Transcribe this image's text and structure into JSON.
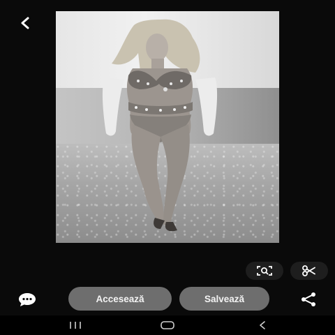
{
  "top_bar": {
    "back_icon": "chevron-left-icon"
  },
  "photo": {
    "description_icon": "runway-photo",
    "tone": "grayscale"
  },
  "tools": {
    "lens_icon": "visual-search-icon",
    "cut_icon": "scissors-icon"
  },
  "actions": {
    "comment_icon": "comment-icon",
    "visit_label": "Accesează",
    "save_label": "Salvează",
    "share_icon": "share-icon"
  },
  "nav": {
    "recents_icon": "recents-icon",
    "home_icon": "home-icon",
    "back_icon": "nav-back-icon"
  },
  "colors": {
    "background": "#0a0a0a",
    "pill": "#6e6e6e",
    "tool_bg": "#1e1e1e",
    "nav_bg": "#000000",
    "icon": "#ffffff"
  }
}
